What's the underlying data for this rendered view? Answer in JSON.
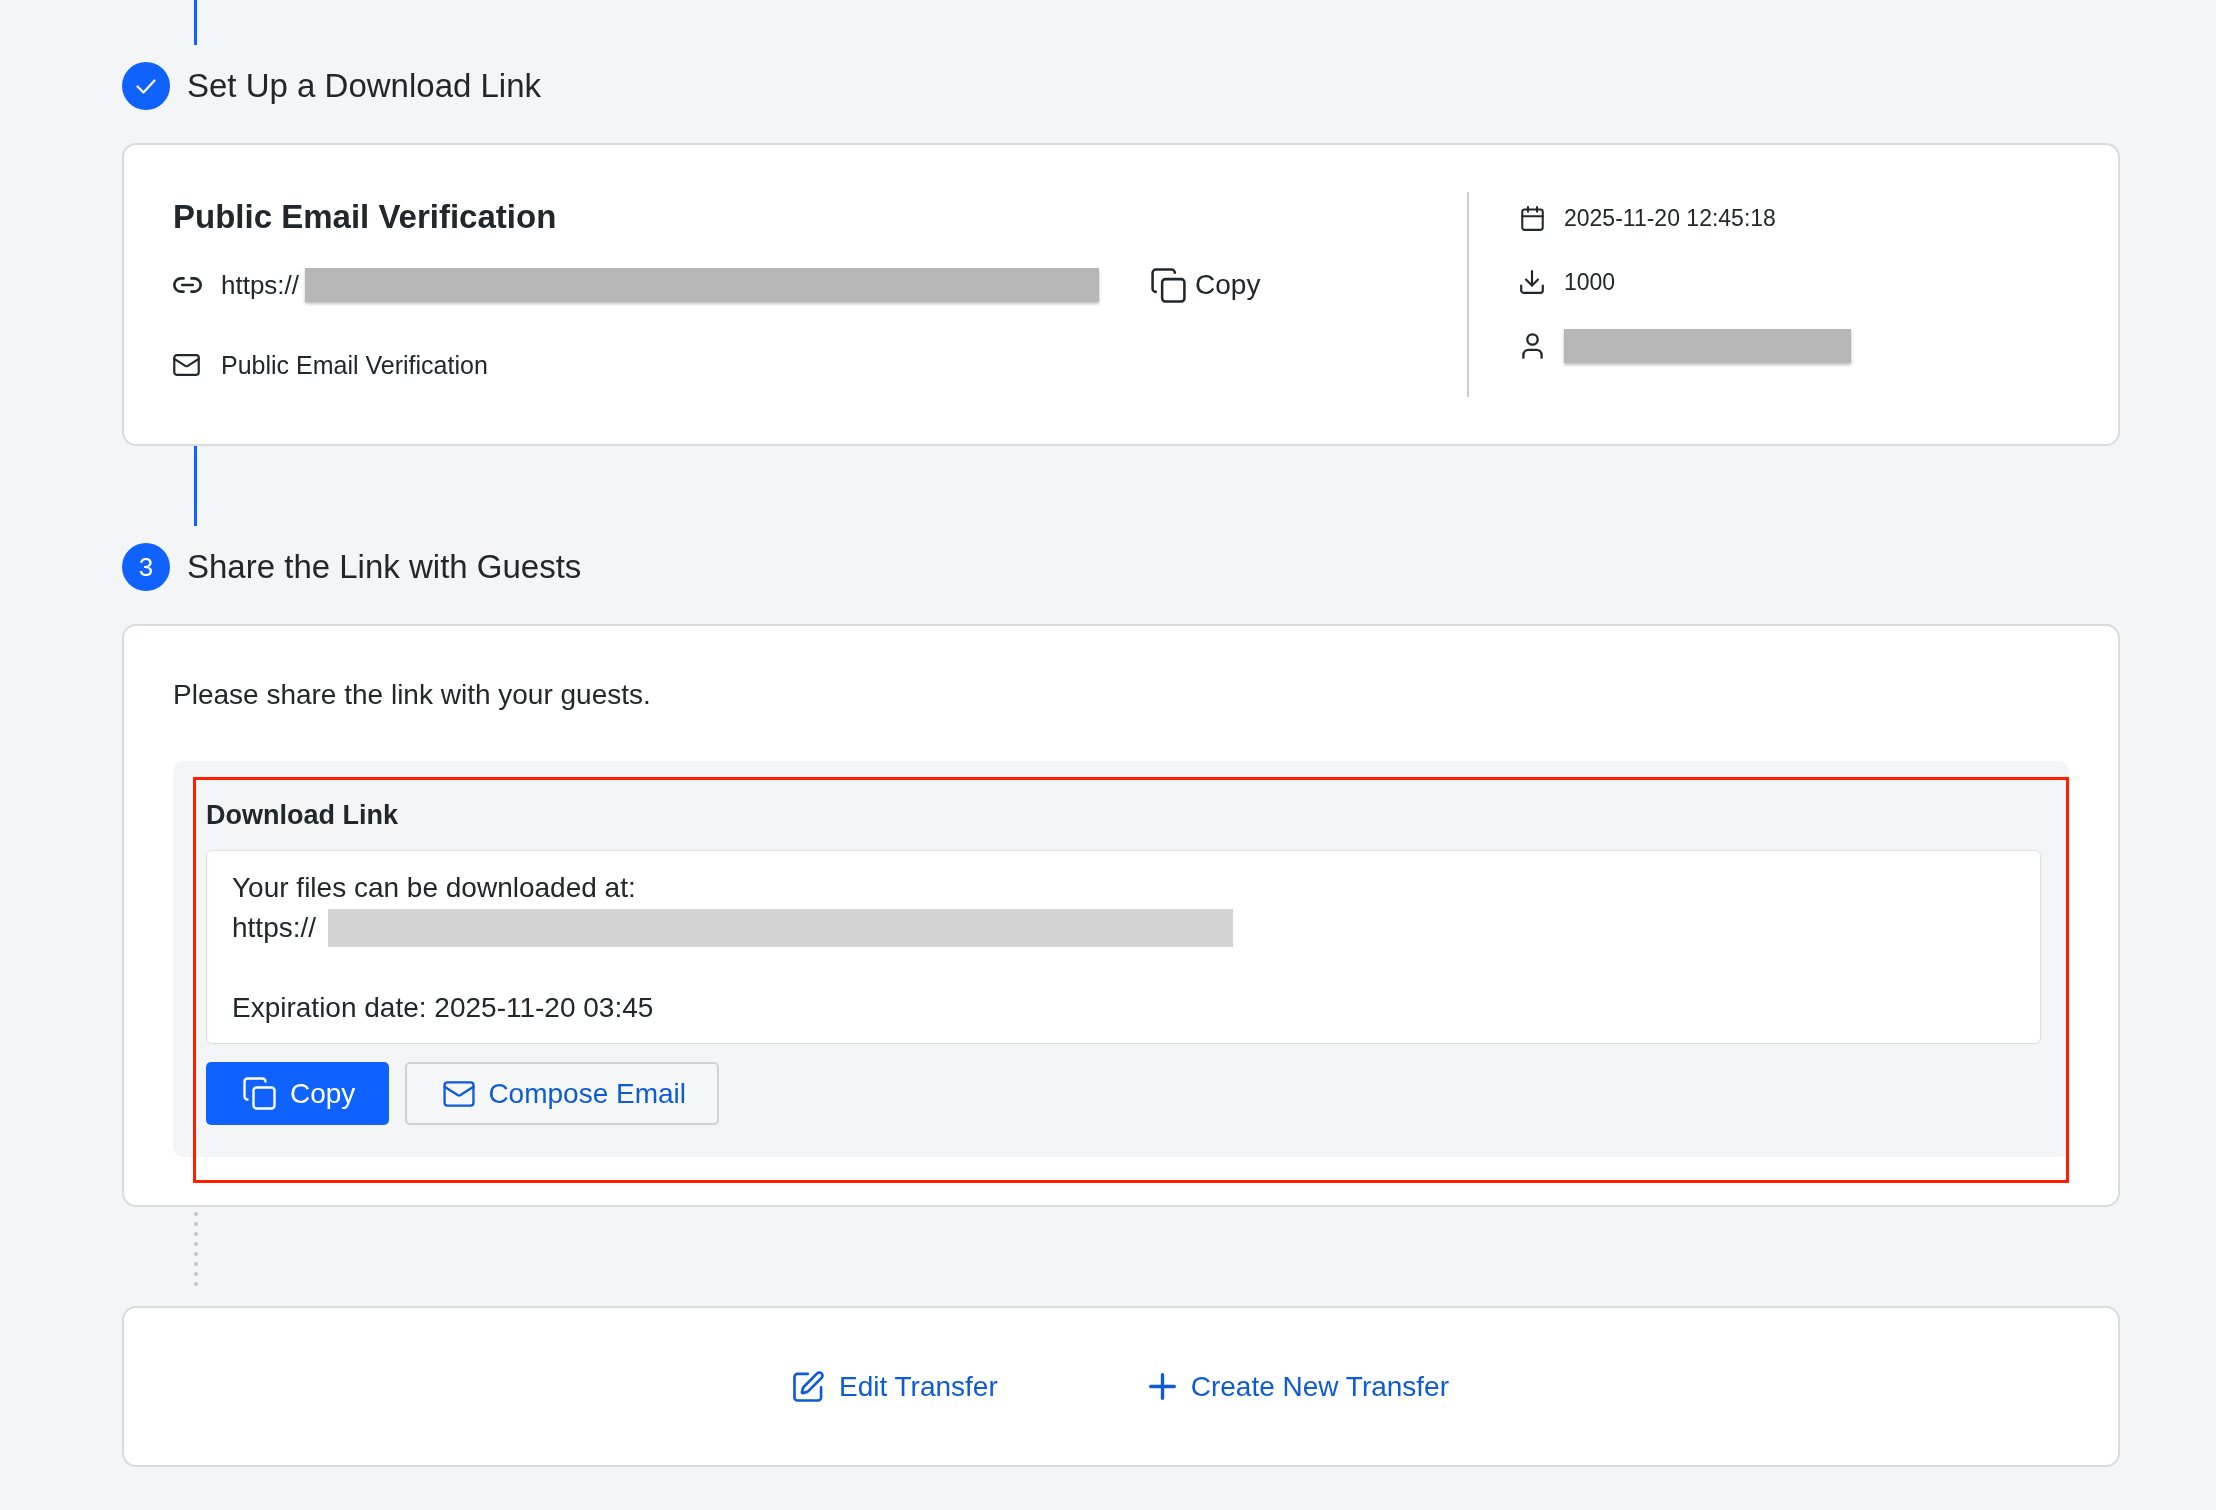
{
  "steps": [
    {
      "kind": "done",
      "title": "Set Up a Download Link",
      "card": {
        "kind": "link_summary",
        "title": "Public Email Verification",
        "link": {
          "prefix": "https://",
          "redacted": true
        },
        "copy_label": "Copy",
        "email": "Public Email Verification",
        "details": [
          {
            "kind": "date",
            "text": "2025-11-20 12:45:18"
          },
          {
            "kind": "downloads",
            "text": "1000"
          },
          {
            "kind": "user",
            "redacted": true
          }
        ]
      }
    },
    {
      "kind": "numbered",
      "number": "3",
      "title": "Share the Link with Guests",
      "card": {
        "kind": "share",
        "intro": "Please share the link with your guests.",
        "panel": {
          "highlighted": true,
          "title": "Download Link",
          "message": {
            "intro": "Your files can be downloaded at:",
            "link_prefix": "https://",
            "link_redacted": true,
            "expiration": "Expiration date: 2025-11-20 03:45"
          },
          "buttons": [
            {
              "kind": "primary",
              "label": "Copy"
            },
            {
              "kind": "secondary",
              "label": "Compose Email"
            }
          ]
        }
      }
    }
  ],
  "actions": [
    {
      "kind": "edit",
      "label": "Edit Transfer"
    },
    {
      "kind": "create",
      "label": "Create New Transfer"
    }
  ]
}
